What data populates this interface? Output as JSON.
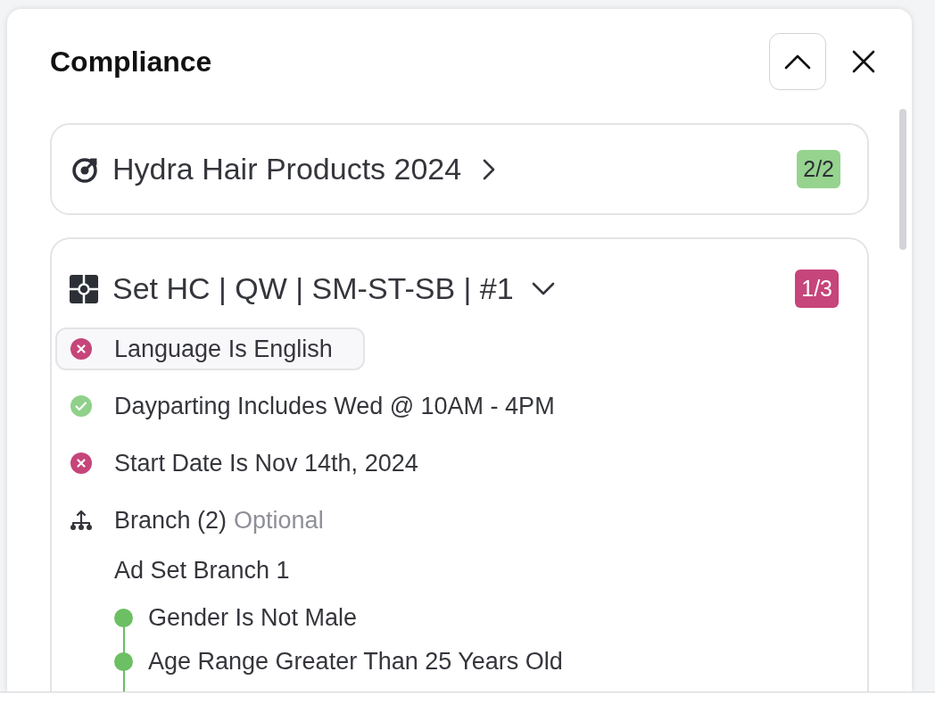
{
  "panel": {
    "title": "Compliance"
  },
  "campaign": {
    "title": "Hydra Hair Products 2024",
    "badge": "2/2",
    "passed": true
  },
  "ad_set": {
    "title": "Set HC | QW | SM-ST-SB | #1",
    "badge": "1/3",
    "passed": false,
    "expanded": true,
    "rules": [
      {
        "text": "Language Is English",
        "passed": false,
        "highlighted": true
      },
      {
        "text": "Dayparting Includes Wed @ 10AM - 4PM",
        "passed": true,
        "highlighted": false
      },
      {
        "text": "Start Date Is Nov 14th, 2024",
        "passed": false,
        "highlighted": false
      }
    ],
    "branch": {
      "label": "Branch (2)",
      "note": "Optional",
      "name": "Ad Set Branch 1",
      "conditions": [
        {
          "text": "Gender Is Not Male",
          "passed": true
        },
        {
          "text": "Age Range Greater Than 25 Years Old",
          "passed": true
        }
      ]
    }
  }
}
